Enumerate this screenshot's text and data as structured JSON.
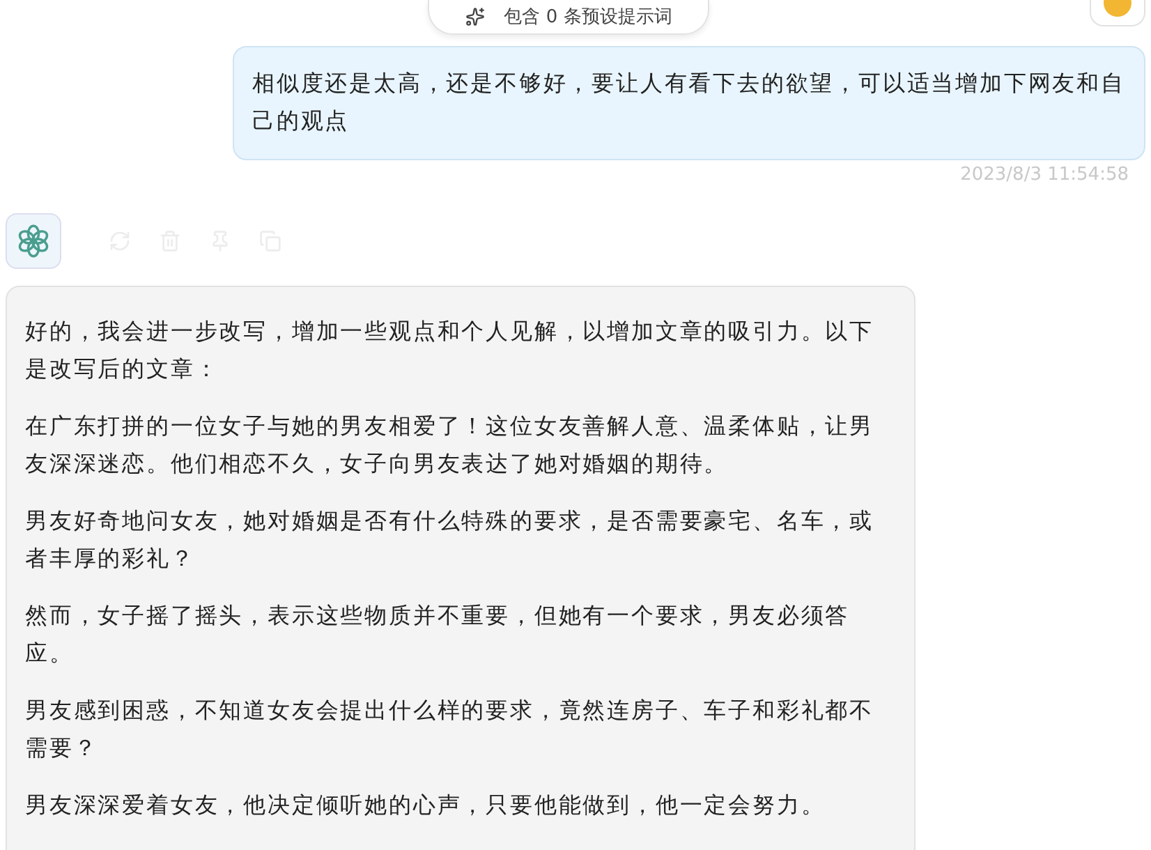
{
  "prompt_pill": {
    "label": "包含 0 条预设提示词"
  },
  "messages": [
    {
      "kind": "user",
      "text": "相似度还是太高，还是不够好，要让人有看下去的欲望，可以适当增加下网友和自己的观点",
      "time": "2023/8/3 11:54:58"
    },
    {
      "kind": "assistant",
      "paragraphs": [
        "好的，我会进一步改写，增加一些观点和个人见解，以增加文章的吸引力。以下是改写后的文章：",
        "在广东打拼的一位女子与她的男友相爱了！这位女友善解人意、温柔体贴，让男友深深迷恋。他们相恋不久，女子向男友表达了她对婚姻的期待。",
        "男友好奇地问女友，她对婚姻是否有什么特殊的要求，是否需要豪宅、名车，或者丰厚的彩礼？",
        "然而，女子摇了摇头，表示这些物质并不重要，但她有一个要求，男友必须答应。",
        "男友感到困惑，不知道女友会提出什么样的要求，竟然连房子、车子和彩礼都不需要？",
        "男友深深爱着女友，他决定倾听她的心声，只要他能做到，他一定会努力。"
      ]
    }
  ]
}
